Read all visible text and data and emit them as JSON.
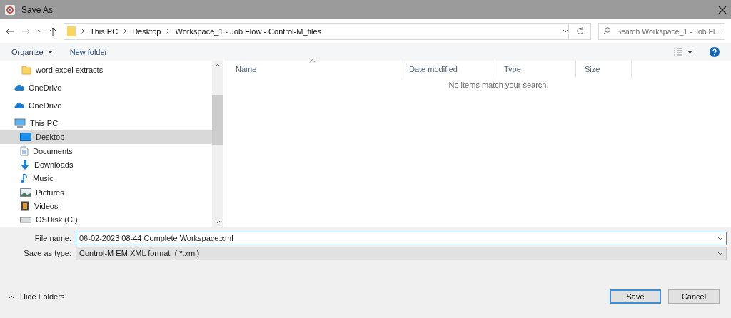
{
  "window": {
    "title": "Save As"
  },
  "navigation": {
    "path": [
      "This PC",
      "Desktop",
      "Workspace_1 - Job Flow - Control-M_files"
    ],
    "search": {
      "placeholder": "Search Workspace_1 - Job Fl..."
    }
  },
  "toolbar": {
    "items": [
      {
        "label": "Organize",
        "kind": "menu"
      },
      {
        "label": "New folder",
        "kind": "button"
      }
    ]
  },
  "sidebar": {
    "items": [
      {
        "label": "word excel extracts",
        "kind": "folder",
        "selected": false
      },
      {
        "label": "OneDrive",
        "kind": "cloud",
        "selected": false
      },
      {
        "label": "OneDrive",
        "kind": "cloud",
        "selected": false
      },
      {
        "label": "This PC",
        "kind": "pc",
        "selected": false,
        "children": [
          {
            "label": "Desktop",
            "kind": "desktop",
            "selected": true
          },
          {
            "label": "Documents",
            "kind": "documents",
            "selected": false
          },
          {
            "label": "Downloads",
            "kind": "downloads",
            "selected": false
          },
          {
            "label": "Music",
            "kind": "music",
            "selected": false
          },
          {
            "label": "Pictures",
            "kind": "pictures",
            "selected": false
          },
          {
            "label": "Videos",
            "kind": "videos",
            "selected": false
          },
          {
            "label": "OSDisk (C:)",
            "kind": "drive",
            "selected": false
          }
        ]
      }
    ]
  },
  "file_list": {
    "columns": [
      {
        "label": "Name",
        "sorted": true
      },
      {
        "label": "Date modified",
        "sorted": false
      },
      {
        "label": "Type",
        "sorted": false
      },
      {
        "label": "Size",
        "sorted": false
      }
    ],
    "empty_message": "No items match your search."
  },
  "form": {
    "file_name": {
      "label": "File name:",
      "value": "06-02-2023 08-44 Complete Workspace.xml"
    },
    "save_as_type": {
      "label": "Save as type:",
      "value": "Control-M EM XML format  ( *.xml)"
    }
  },
  "footer": {
    "hide_folders": "Hide Folders",
    "buttons": [
      {
        "label": "Save",
        "default": true
      },
      {
        "label": "Cancel",
        "default": false
      }
    ]
  }
}
